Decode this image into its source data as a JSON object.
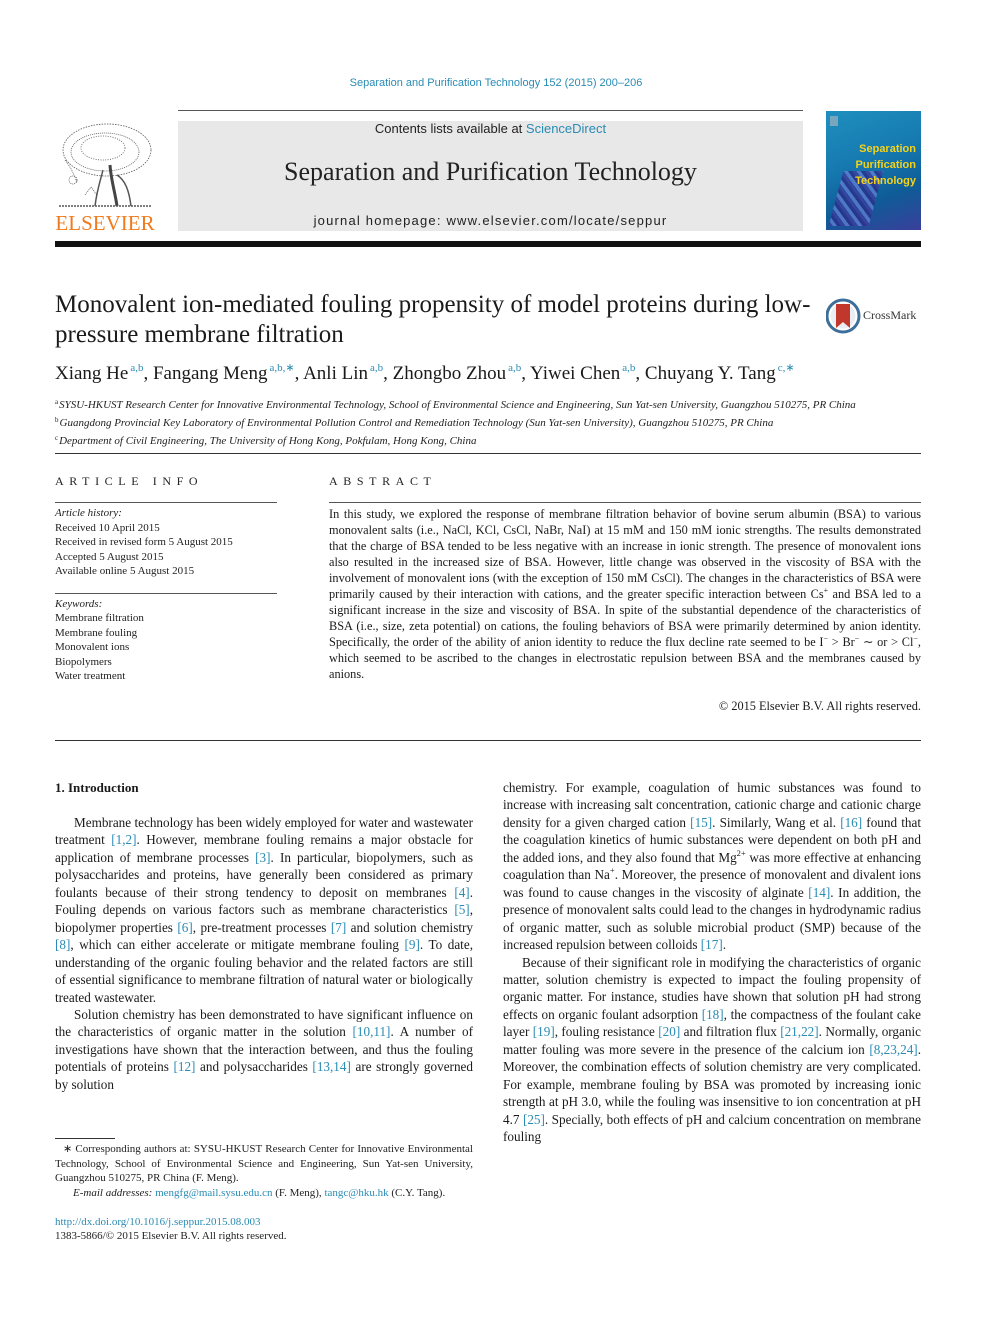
{
  "header": {
    "journal_ref": "Separation and Purification Technology 152 (2015) 200–206",
    "contents_prefix": "Contents lists available at ",
    "contents_link": "ScienceDirect",
    "journal_name": "Separation and Purification Technology",
    "homepage": "journal homepage: www.elsevier.com/locate/seppur",
    "publisher_logo_text": "ELSEVIER",
    "cover_title_lines": [
      "Separation",
      "Purification",
      "Technology"
    ],
    "colors": {
      "link": "#2a8bb4",
      "elsevier_orange": "#f07b1e",
      "cover_title": "#f4d21a"
    }
  },
  "article": {
    "title": "Monovalent ion-mediated fouling propensity of model proteins during low-pressure membrane filtration",
    "crossmark_label": "CrossMark",
    "authors": [
      {
        "name": "Xiang He",
        "sup": "a,b"
      },
      {
        "name": "Fangang Meng",
        "sup": "a,b,∗"
      },
      {
        "name": "Anli Lin",
        "sup": "a,b"
      },
      {
        "name": "Zhongbo Zhou",
        "sup": "a,b"
      },
      {
        "name": "Yiwei Chen",
        "sup": "a,b"
      },
      {
        "name": "Chuyang Y. Tang",
        "sup": "c,∗"
      }
    ],
    "affiliations": [
      {
        "mark": "a",
        "text": "SYSU-HKUST Research Center for Innovative Environmental Technology, School of Environmental Science and Engineering, Sun Yat-sen University, Guangzhou 510275, PR China"
      },
      {
        "mark": "b",
        "text": "Guangdong Provincial Key Laboratory of Environmental Pollution Control and Remediation Technology (Sun Yat-sen University), Guangzhou 510275, PR China"
      },
      {
        "mark": "c",
        "text": "Department of Civil Engineering, The University of Hong Kong, Pokfulam, Hong Kong, China"
      }
    ]
  },
  "article_info": {
    "heading": "ARTICLE INFO",
    "history_label": "Article history:",
    "history": [
      "Received 10 April 2015",
      "Received in revised form 5 August 2015",
      "Accepted 5 August 2015",
      "Available online 5 August 2015"
    ],
    "keywords_label": "Keywords:",
    "keywords": [
      "Membrane filtration",
      "Membrane fouling",
      "Monovalent ions",
      "Biopolymers",
      "Water treatment"
    ]
  },
  "abstract": {
    "heading": "ABSTRACT",
    "segments": [
      {
        "t": "In this study, we explored the response of membrane filtration behavior of bovine serum albumin (BSA) to various monovalent salts (i.e., NaCl, KCl, CsCl, NaBr, NaI) at 15 mM and 150 mM ionic strengths. The results demonstrated that the charge of BSA tended to be less negative with an increase in ionic strength. The presence of monovalent ions also resulted in the increased size of BSA. However, little change was observed in the viscosity of BSA with the involvement of monovalent ions (with the exception of 150 mM CsCl). The changes in the characteristics of BSA were primarily caused by their interaction with cations, and the greater specific interaction between Cs"
      },
      {
        "sup": "+"
      },
      {
        "t": " and BSA led to a significant increase in the size and viscosity of BSA. In spite of the substantial dependence of the characteristics of BSA (i.e., size, zeta potential) on cations, the fouling behaviors of BSA were primarily determined by anion identity. Specifically, the order of the ability of anion identity to reduce the flux decline rate seemed to be I"
      },
      {
        "sup": "−"
      },
      {
        "t": " > Br"
      },
      {
        "sup": "−"
      },
      {
        "t": " ∼ or > Cl"
      },
      {
        "sup": "−"
      },
      {
        "t": ", which seemed to be ascribed to the changes in electrostatic repulsion between BSA and the membranes caused by anions."
      }
    ],
    "copyright": "© 2015 Elsevier B.V. All rights reserved."
  },
  "body": {
    "section_heading": "1. Introduction",
    "left_paragraphs": [
      [
        {
          "t": "Membrane technology has been widely employed for water and wastewater treatment "
        },
        {
          "ref": "[1,2]"
        },
        {
          "t": ". However, membrane fouling remains a major obstacle for application of membrane processes "
        },
        {
          "ref": "[3]"
        },
        {
          "t": ". In particular, biopolymers, such as polysaccharides and proteins, have generally been considered as primary foulants because of their strong tendency to deposit on membranes "
        },
        {
          "ref": "[4]"
        },
        {
          "t": ". Fouling depends on various factors such as membrane characteristics "
        },
        {
          "ref": "[5]"
        },
        {
          "t": ", biopoly­mer properties "
        },
        {
          "ref": "[6]"
        },
        {
          "t": ", pre-treatment processes "
        },
        {
          "ref": "[7]"
        },
        {
          "t": " and solution chemistry "
        },
        {
          "ref": "[8]"
        },
        {
          "t": ", which can either accelerate or mitigate membrane fouling "
        },
        {
          "ref": "[9]"
        },
        {
          "t": ". To date, understanding of the organic fouling behavior and the related factors are still of essential significance to mem­brane filtration of natural water or biologically treated wastewater."
        }
      ],
      [
        {
          "t": "Solution chemistry has been demonstrated to have significant influence on the characteristics of organic matter in the solution "
        },
        {
          "ref": "[10,11]"
        },
        {
          "t": ". A number of investigations have shown that the interaction between, and thus the fouling potentials of proteins "
        },
        {
          "ref": "[12]"
        },
        {
          "t": " and polysaccharides "
        },
        {
          "ref": "[13,14]"
        },
        {
          "t": " are strongly governed by solution"
        }
      ]
    ],
    "right_paragraphs": [
      [
        {
          "t": "chemistry. For example, coagulation of humic substances was found to increase with increasing salt concentration, cationic charge and cationic charge density for a given charged cation "
        },
        {
          "ref": "[15]"
        },
        {
          "t": ". Similarly, Wang et al. "
        },
        {
          "ref": "[16]"
        },
        {
          "t": " found that the coagulation kinetics of humic substances were dependent on both pH and the added ions, and they also found that Mg"
        },
        {
          "sup": "2+"
        },
        {
          "t": " was more effective at enhanc­ing coagulation than Na"
        },
        {
          "sup": "+"
        },
        {
          "t": ". Moreover, the presence of monovalent and divalent ions was found to cause changes in the viscosity of alginate "
        },
        {
          "ref": "[14]"
        },
        {
          "t": ". In addition, the presence of monovalent salts could lead to the changes in hydrodynamic radius of organic matter, such as soluble microbial product (SMP) because of the increased repul­sion between colloids "
        },
        {
          "ref": "[17]"
        },
        {
          "t": "."
        }
      ],
      [
        {
          "t": "Because of their significant role in modifying the characteristics of organic matter, solution chemistry is expected to impact the fouling propensity of organic matter. For instance, studies have shown that solution pH had strong effects on organic foulant adsorption "
        },
        {
          "ref": "[18]"
        },
        {
          "t": ", the compactness of the foulant cake layer "
        },
        {
          "ref": "[19]"
        },
        {
          "t": ", fouling resistance "
        },
        {
          "ref": "[20]"
        },
        {
          "t": " and filtration flux "
        },
        {
          "ref": "[21,22]"
        },
        {
          "t": ". Normally, organic matter fouling was more severe in the presence of the calcium ion "
        },
        {
          "ref": "[8,23,24]"
        },
        {
          "t": ". Moreover, the combination effects of solution chemistry are very complicated. For example, membrane fouling by BSA was promoted by increasing ionic strength at pH 3.0, while the fouling was insensitive to ion concentration at pH 4.7 "
        },
        {
          "ref": "[25]"
        },
        {
          "t": ". Specially, both effects of pH and calcium concentration on membrane fouling"
        }
      ]
    ]
  },
  "footnotes": {
    "corresponding": "∗ Corresponding authors at: SYSU-HKUST Research Center for Innovative Environmental Technology, School of Environmental Science and Engineering, Sun Yat-sen University, Guangzhou 510275, PR China (F. Meng).",
    "email_label": "E-mail addresses: ",
    "emails": [
      {
        "address": "mengfg@mail.sysu.edu.cn",
        "who": " (F. Meng), "
      },
      {
        "address": "tangc@hku.hk",
        "who": " (C.Y. Tang)."
      }
    ],
    "doi": "http://dx.doi.org/10.1016/j.seppur.2015.08.003",
    "issn": "1383-5866/© 2015 Elsevier B.V. All rights reserved."
  }
}
